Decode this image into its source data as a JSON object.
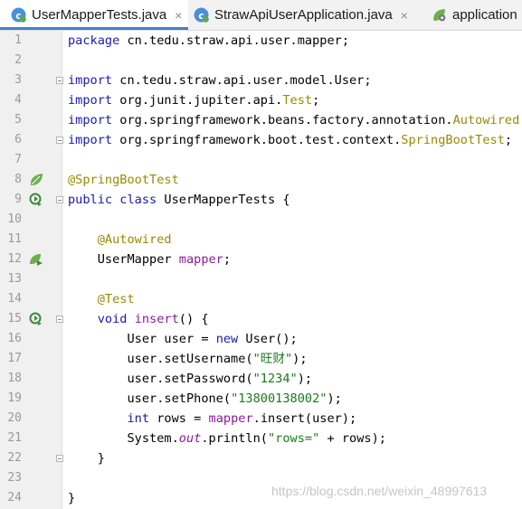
{
  "tabs": [
    {
      "label": "UserMapperTests.java",
      "icon": "java-class-icon",
      "active": true
    },
    {
      "label": "StrawApiUserApplication.java",
      "icon": "java-class-icon",
      "active": false
    },
    {
      "label": "application",
      "icon": "spring-config-icon",
      "active": false
    }
  ],
  "close_glyph": "×",
  "lines": [
    {
      "n": "1",
      "segs": [
        [
          "kw",
          "package"
        ],
        [
          "p",
          " cn.tedu.straw.api.user.mapper;"
        ]
      ]
    },
    {
      "n": "2",
      "segs": []
    },
    {
      "n": "3",
      "segs": [
        [
          "kw",
          "import"
        ],
        [
          "p",
          " cn.tedu.straw.api.user.model.User;"
        ]
      ]
    },
    {
      "n": "4",
      "segs": [
        [
          "kw",
          "import"
        ],
        [
          "p",
          " org.junit.jupiter.api."
        ],
        [
          "ann",
          "Test"
        ],
        [
          "p",
          ";"
        ]
      ]
    },
    {
      "n": "5",
      "segs": [
        [
          "kw",
          "import"
        ],
        [
          "p",
          " org.springframework.beans.factory.annotation."
        ],
        [
          "ann",
          "Autowired"
        ],
        [
          "p",
          ";"
        ]
      ]
    },
    {
      "n": "6",
      "segs": [
        [
          "kw",
          "import"
        ],
        [
          "p",
          " org.springframework.boot.test.context."
        ],
        [
          "ann",
          "SpringBootTest"
        ],
        [
          "p",
          ";"
        ]
      ]
    },
    {
      "n": "7",
      "segs": []
    },
    {
      "n": "8",
      "segs": [
        [
          "ann",
          "@SpringBootTest"
        ]
      ]
    },
    {
      "n": "9",
      "segs": [
        [
          "kw",
          "public class"
        ],
        [
          "p",
          " UserMapperTests {"
        ]
      ]
    },
    {
      "n": "10",
      "segs": []
    },
    {
      "n": "11",
      "segs": [
        [
          "p",
          "    "
        ],
        [
          "ann",
          "@Autowired"
        ]
      ]
    },
    {
      "n": "12",
      "segs": [
        [
          "p",
          "    UserMapper "
        ],
        [
          "fld",
          "mapper"
        ],
        [
          "p",
          ";"
        ]
      ]
    },
    {
      "n": "13",
      "segs": []
    },
    {
      "n": "14",
      "segs": [
        [
          "p",
          "    "
        ],
        [
          "ann",
          "@Test"
        ]
      ]
    },
    {
      "n": "15",
      "segs": [
        [
          "p",
          "    "
        ],
        [
          "kw",
          "void"
        ],
        [
          "p",
          " "
        ],
        [
          "fld",
          "insert"
        ],
        [
          "p",
          "() {"
        ]
      ]
    },
    {
      "n": "16",
      "segs": [
        [
          "p",
          "        User user = "
        ],
        [
          "kw",
          "new"
        ],
        [
          "p",
          " User();"
        ]
      ]
    },
    {
      "n": "17",
      "segs": [
        [
          "p",
          "        user.setUsername("
        ],
        [
          "str",
          "\"旺财\""
        ],
        [
          "p",
          ");"
        ]
      ]
    },
    {
      "n": "18",
      "segs": [
        [
          "p",
          "        user.setPassword("
        ],
        [
          "str",
          "\"1234\""
        ],
        [
          "p",
          ");"
        ]
      ]
    },
    {
      "n": "19",
      "segs": [
        [
          "p",
          "        user.setPhone("
        ],
        [
          "str",
          "\"13800138002\""
        ],
        [
          "p",
          ");"
        ]
      ]
    },
    {
      "n": "20",
      "segs": [
        [
          "p",
          "        "
        ],
        [
          "kw",
          "int"
        ],
        [
          "p",
          " rows = "
        ],
        [
          "fld",
          "mapper"
        ],
        [
          "p",
          ".insert(user);"
        ]
      ]
    },
    {
      "n": "21",
      "segs": [
        [
          "p",
          "        System."
        ],
        [
          "sfld",
          "out"
        ],
        [
          "p",
          ".println("
        ],
        [
          "str",
          "\"rows=\""
        ],
        [
          "p",
          " + rows);"
        ]
      ]
    },
    {
      "n": "22",
      "segs": [
        [
          "p",
          "    }"
        ]
      ]
    },
    {
      "n": "23",
      "segs": []
    },
    {
      "n": "24",
      "segs": [
        [
          "p",
          "}"
        ]
      ]
    }
  ],
  "gutter_icons": [
    {
      "line": "8",
      "icon": "spring-bean-icon"
    },
    {
      "line": "9",
      "icon": "run-test-icon"
    },
    {
      "line": "12",
      "icon": "autowired-bean-icon"
    },
    {
      "line": "15",
      "icon": "run-test-icon"
    }
  ],
  "fold_lines": [
    "3",
    "6",
    "9",
    "15",
    "22"
  ],
  "watermark": "https://blog.csdn.net/weixin_48997613",
  "colors": {
    "keyword": "#1a1ab0",
    "annotation": "#9a8a00",
    "string": "#1a7a1a",
    "field": "#8a1a9a",
    "tab_underline": "#4083c9",
    "spring_green": "#6ab04c"
  }
}
